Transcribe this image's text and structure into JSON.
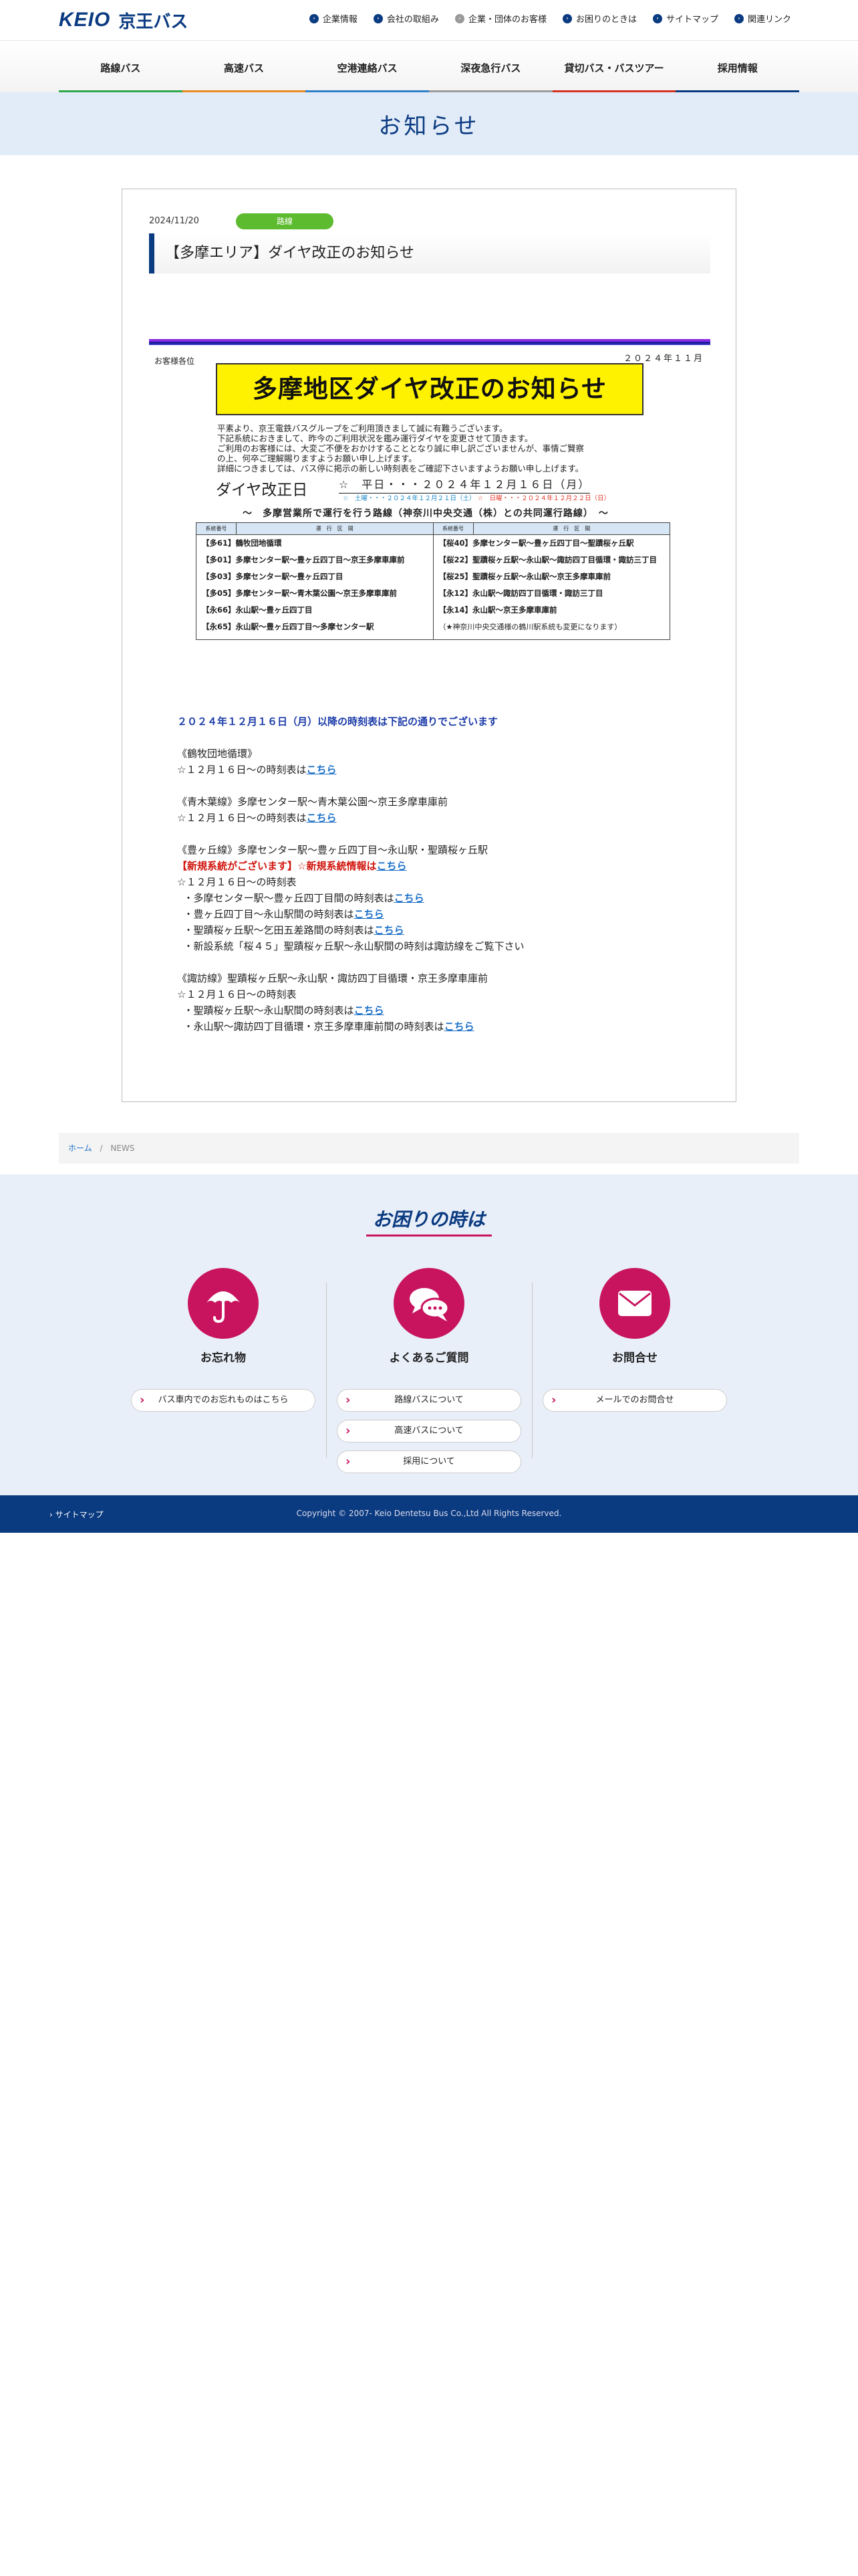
{
  "header": {
    "logo_en": "KEIO",
    "logo_jp": "京王バス",
    "util_nav": [
      "企業情報",
      "会社の取組み",
      "企業・団体のお客様",
      "お困りのときは",
      "サイトマップ",
      "関連リンク"
    ],
    "global_nav": [
      "路線バス",
      "高速バス",
      "空港連絡バス",
      "深夜急行バス",
      "貸切バス・バスツアー",
      "採用情報"
    ]
  },
  "hero": {
    "title": "お知らせ"
  },
  "article": {
    "date": "2024/11/20",
    "category": "路線",
    "title": "【多摩エリア】ダイヤ改正のお知らせ",
    "notice": {
      "recipient": "お客様各位",
      "date": "２０２４年１１月",
      "headline": "多摩地区ダイヤ改正のお知らせ",
      "body": [
        "平素より、京王電鉄バスグループをご利用頂きまして誠に有難うございます。",
        "下記系統におきまして、昨今のご利用状況を鑑み運行ダイヤを変更させて頂きます。",
        "ご利用のお客様には、大変ご不便をおかけすることとなり誠に申し訳ございませんが、事情ご賢察",
        "の上、何卒ご理解賜りますようお願い申し上げます。",
        "詳細につきましては、バス停に掲示の新しい時刻表をご確認下さいますようお願い申し上げます。"
      ],
      "kaisei_label": "ダイヤ改正日",
      "kaisei_value": "☆　平日・・・２０２４年１２月１６日（月）",
      "kaisei_sat": "☆　土曜・・・２０２４年１２月２１日（土）",
      "kaisei_hol": "☆　日曜・・・２０２４年１２月２２日（日）",
      "table_heading": "〜　多摩営業所で運行を行う路線（神奈川中央交通（株）との共同運行路線）　〜",
      "table_col_head": [
        "系統番号",
        "運　行　区　間"
      ],
      "left_rows": [
        "【多61】鶴牧団地循環",
        "【多01】多摩センター駅〜豊ヶ丘四丁目〜京王多摩車庫前",
        "【多03】多摩センター駅〜豊ヶ丘四丁目",
        "【多05】多摩センター駅〜青木葉公園〜京王多摩車庫前",
        "【永66】永山駅〜豊ヶ丘四丁目",
        "【永65】永山駅〜豊ヶ丘四丁目〜多摩センター駅"
      ],
      "right_rows": [
        "【桜40】多摩センター駅〜豊ヶ丘四丁目〜聖蹟桜ヶ丘駅",
        "【桜22】聖蹟桜ヶ丘駅〜永山駅〜諏訪四丁目循環・諏訪三丁目",
        "【桜25】聖蹟桜ヶ丘駅〜永山駅〜京王多摩車庫前",
        "【永12】永山駅〜諏訪四丁目循環・諏訪三丁目",
        "【永14】永山駅〜京王多摩車庫前",
        "（★神奈川中央交通様の鶴川駅系統も変更になります）"
      ]
    },
    "intro": "２０２４年１２月１６日（月）以降の時刻表は下記の通りでございます",
    "sections": {
      "s1_title": "《鶴牧団地循環》",
      "s1_line": "☆１２月１６日〜の時刻表は",
      "s2_title": "《青木葉線》多摩センター駅〜青木葉公園〜京王多摩車庫前",
      "s2_line": "☆１２月１６日〜の時刻表は",
      "s3_title": "《豊ヶ丘線》多摩センター駅〜豊ヶ丘四丁目〜永山駅・聖蹟桜ヶ丘駅",
      "s3_new": "【新規系統がございます】☆新規系統情報は",
      "s3_line": "☆１２月１６日〜の時刻表",
      "s3_i1": "・多摩センター駅〜豊ヶ丘四丁目間の時刻表は",
      "s3_i2": "・豊ヶ丘四丁目〜永山駅間の時刻表は",
      "s3_i3": "・聖蹟桜ヶ丘駅〜乞田五差路間の時刻表は",
      "s3_i4": "・新設系統「桜４５」聖蹟桜ヶ丘駅〜永山駅間の時刻は諏訪線をご覧下さい",
      "s4_title": "《諏訪線》聖蹟桜ヶ丘駅〜永山駅・諏訪四丁目循環・京王多摩車庫前",
      "s4_line": "☆１２月１６日〜の時刻表",
      "s4_i1": "・聖蹟桜ヶ丘駅〜永山駅間の時刻表は",
      "s4_i2": "・永山駅〜諏訪四丁目循環・京王多摩車庫前間の時刻表は",
      "link": "こちら"
    }
  },
  "breadcrumb": {
    "home": "ホーム",
    "sep": "/",
    "current": "NEWS"
  },
  "trouble": {
    "title": "お困りの時は",
    "col1": {
      "label": "お忘れ物",
      "buttons": [
        "バス車内でのお忘れものはこちら"
      ]
    },
    "col2": {
      "label": "よくあるご質問",
      "buttons": [
        "路線バスについて",
        "高速バスについて",
        "採用について"
      ]
    },
    "col3": {
      "label": "お問合せ",
      "buttons": [
        "メールでのお問合せ"
      ]
    },
    "accent": "#c8145f"
  },
  "footer": {
    "sitemap": "サイトマップ",
    "copyright": "Copyright © 2007- Keio Dentetsu Bus Co.,Ltd All Rights Reserved."
  },
  "colors": {
    "brand": "#0a3a80",
    "hero_bg": "#e2ecf9",
    "badge": "#5dbb2f"
  }
}
